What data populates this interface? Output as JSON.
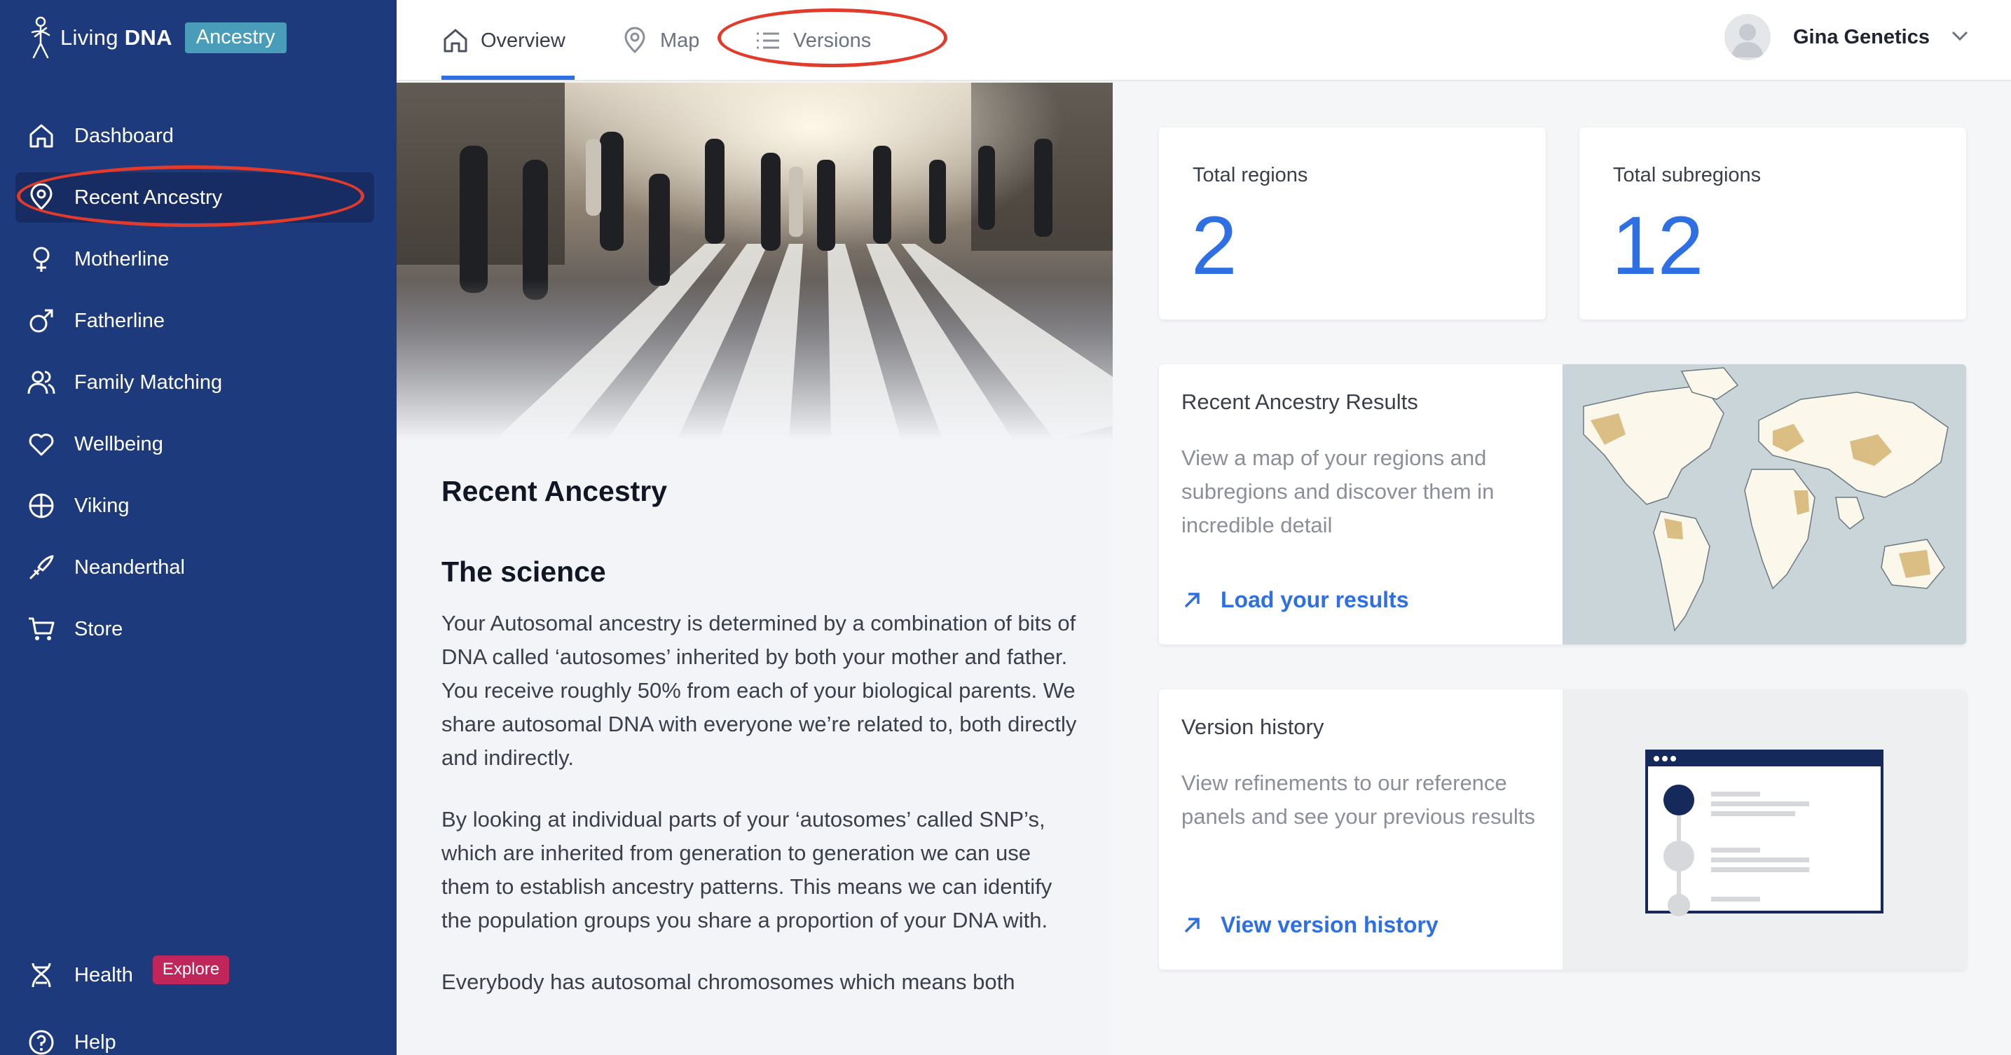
{
  "brand": {
    "name_light": "Living",
    "name_bold": "DNA",
    "badge": "Ancestry"
  },
  "sidebar": {
    "items": [
      {
        "label": "Dashboard",
        "icon": "home-icon"
      },
      {
        "label": "Recent Ancestry",
        "icon": "location-pin-icon",
        "active": true
      },
      {
        "label": "Motherline",
        "icon": "female-symbol-icon"
      },
      {
        "label": "Fatherline",
        "icon": "male-symbol-icon"
      },
      {
        "label": "Family Matching",
        "icon": "people-icon"
      },
      {
        "label": "Wellbeing",
        "icon": "heart-icon"
      },
      {
        "label": "Viking",
        "icon": "shield-cross-icon"
      },
      {
        "label": "Neanderthal",
        "icon": "spear-icon"
      },
      {
        "label": "Store",
        "icon": "cart-icon"
      }
    ],
    "bottom_items": [
      {
        "label": "Health",
        "icon": "dna-helix-icon",
        "badge": "Explore"
      },
      {
        "label": "Help",
        "icon": "question-icon"
      }
    ]
  },
  "tabs": [
    {
      "label": "Overview",
      "icon": "home-icon",
      "active": true
    },
    {
      "label": "Map",
      "icon": "location-pin-icon"
    },
    {
      "label": "Versions",
      "icon": "list-icon"
    }
  ],
  "user": {
    "name": "Gina Genetics"
  },
  "article": {
    "title": "Recent Ancestry",
    "section_heading": "The science",
    "paragraphs": [
      "Your Autosomal ancestry is determined by a combination of bits of DNA called ‘autosomes’ inherited by both your mother and father. You receive roughly 50% from each of your biological parents. We share autosomal DNA with everyone we’re related to, both directly and indirectly.",
      "By looking at individual parts of your ‘autosomes’ called SNP’s, which are inherited from generation to generation we can use them to establish ancestry patterns. This means we can identify the population groups you share a proportion of your DNA with.",
      "Everybody has autosomal chromosomes which means both"
    ]
  },
  "stats": [
    {
      "label": "Total regions",
      "value": "2"
    },
    {
      "label": "Total subregions",
      "value": "12"
    }
  ],
  "cards": {
    "results": {
      "title": "Recent Ancestry Results",
      "description": "View a map of your regions and subregions and discover them in incredible detail",
      "link": "Load your results"
    },
    "versions": {
      "title": "Version history",
      "description": "View refinements to our reference panels and see your previous results",
      "link": "View version history"
    }
  },
  "colors": {
    "sidebar": "#1d3a7c",
    "sidebar_active": "#162c63",
    "accent_blue": "#2f6fe4",
    "badge_teal": "#4a9db8",
    "explore_pink": "#c0265a",
    "annotation_red": "#e33b2b"
  }
}
